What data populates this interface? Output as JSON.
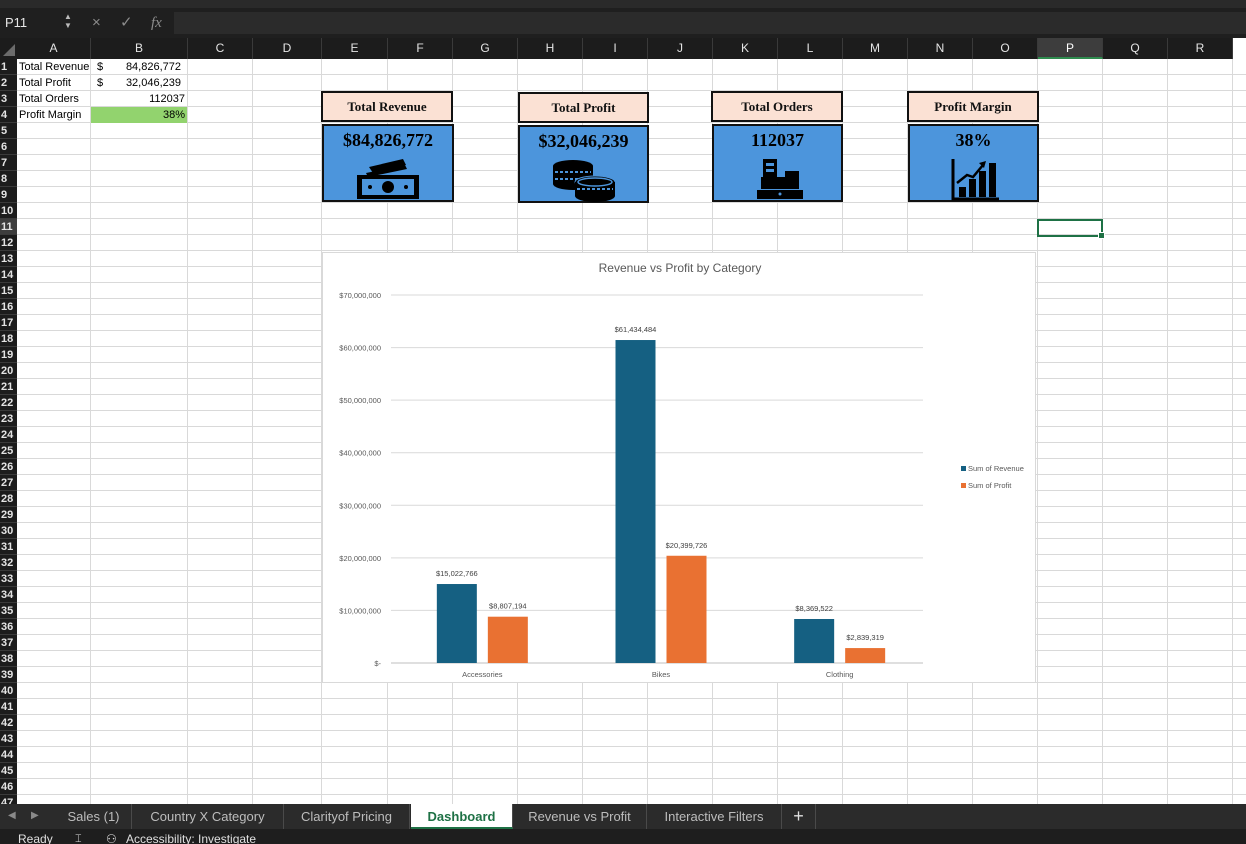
{
  "formula_bar": {
    "name_box": "P11",
    "cancel_icon": "×",
    "enter_icon": "✓",
    "function_icon": "fx",
    "formula_value": ""
  },
  "columns": [
    "A",
    "B",
    "C",
    "D",
    "E",
    "F",
    "G",
    "H",
    "I",
    "J",
    "K",
    "L",
    "M",
    "N",
    "O",
    "P",
    "Q",
    "R"
  ],
  "selected_column": "P",
  "selected_row": 11,
  "rows": [
    "1",
    "2",
    "3",
    "4",
    "5",
    "6",
    "7",
    "8",
    "9",
    "10",
    "11",
    "12",
    "13",
    "14",
    "15",
    "16",
    "17",
    "18",
    "19",
    "20",
    "21",
    "22",
    "23",
    "24",
    "25",
    "26",
    "27",
    "28",
    "29",
    "30",
    "31",
    "32",
    "33",
    "34",
    "35",
    "36",
    "37",
    "38",
    "39",
    "40",
    "41",
    "42",
    "43",
    "44",
    "45",
    "46",
    "47"
  ],
  "summary_table": [
    {
      "label": "Total Revenue",
      "currency": "$",
      "value": "84,826,772"
    },
    {
      "label": "Total Profit",
      "currency": "$",
      "value": "32,046,239"
    },
    {
      "label": "Total Orders",
      "currency": "",
      "value": "112037"
    },
    {
      "label": "Profit Margin",
      "currency": "",
      "value": "38%"
    }
  ],
  "kpis": [
    {
      "title": "Total Revenue",
      "value": "$84,826,772",
      "icon": "cash-icon"
    },
    {
      "title": "Total Profit",
      "value": "$32,046,239",
      "icon": "coins-icon"
    },
    {
      "title": "Total Orders",
      "value": "112037",
      "icon": "cash-register-icon"
    },
    {
      "title": "Profit Margin",
      "value": "38%",
      "icon": "growth-chart-icon"
    }
  ],
  "chart_data": {
    "type": "bar",
    "title": "Revenue vs Profit by Category",
    "categories": [
      "Accessories",
      "Bikes",
      "Clothing"
    ],
    "series": [
      {
        "name": "Sum of Revenue",
        "color": "#156082",
        "values": [
          15022766,
          61434484,
          8369522
        ],
        "labels": [
          "$15,022,766",
          "$61,434,484",
          "$8,369,522"
        ]
      },
      {
        "name": "Sum of Profit",
        "color": "#e97132",
        "values": [
          8807194,
          20399726,
          2839319
        ],
        "labels": [
          "$8,807,194",
          "$20,399,726",
          "$2,839,319"
        ]
      }
    ],
    "ylim": [
      0,
      70000000
    ],
    "yticks": [
      0,
      10000000,
      20000000,
      30000000,
      40000000,
      50000000,
      60000000,
      70000000
    ],
    "ytick_labels": [
      "$-",
      "$10,000,000",
      "$20,000,000",
      "$30,000,000",
      "$40,000,000",
      "$50,000,000",
      "$60,000,000",
      "$70,000,000"
    ],
    "grid": true,
    "legend": "right"
  },
  "tabs": [
    {
      "label": "Sales (1)",
      "active": false
    },
    {
      "label": "Country X Category",
      "active": false
    },
    {
      "label": "Clarityof Pricing",
      "active": false
    },
    {
      "label": "Dashboard",
      "active": true
    },
    {
      "label": "Revenue vs Profit",
      "active": false
    },
    {
      "label": "Interactive Filters",
      "active": false
    }
  ],
  "add_sheet_label": "+",
  "status": {
    "ready": "Ready",
    "accessibility": "Accessibility: Investigate"
  }
}
